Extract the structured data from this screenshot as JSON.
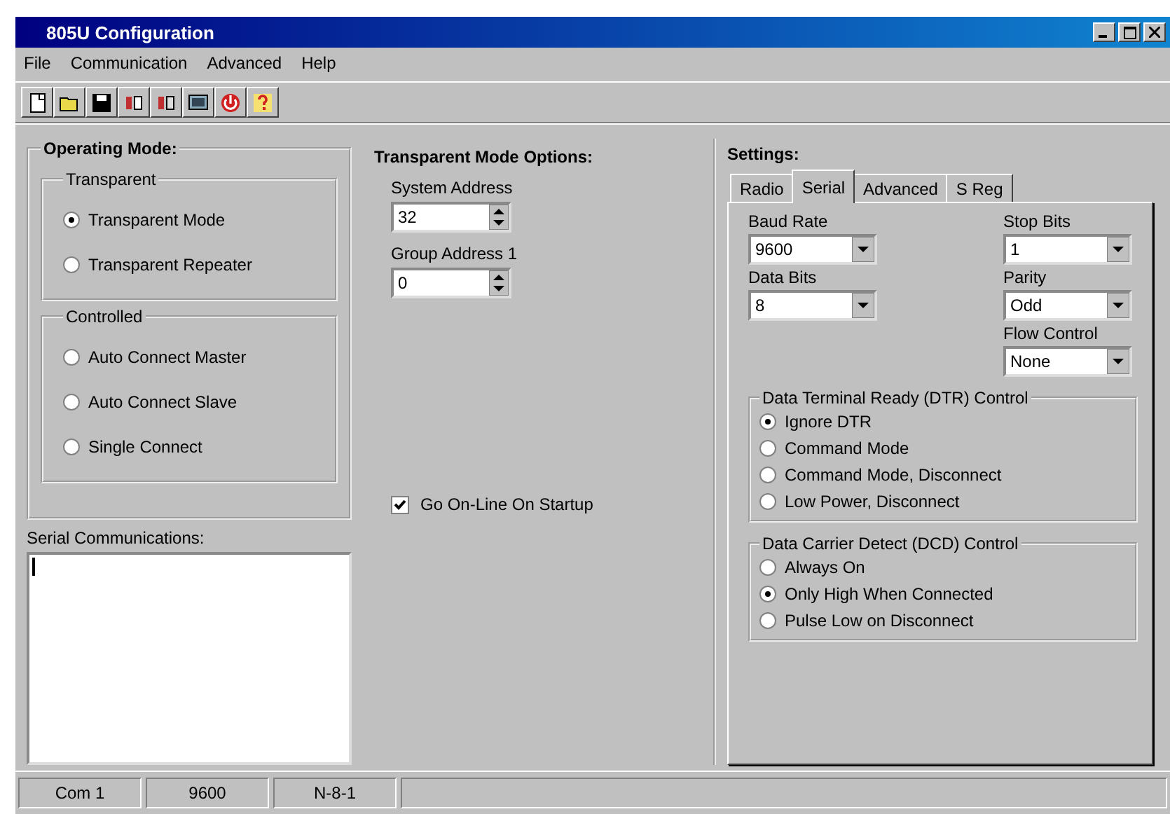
{
  "window": {
    "title": "805U Configuration"
  },
  "menu": [
    {
      "label": "File"
    },
    {
      "label": "Communication"
    },
    {
      "label": "Advanced"
    },
    {
      "label": "Help"
    }
  ],
  "operating_mode": {
    "title": "Operating Mode:",
    "groups": [
      {
        "title": "Transparent",
        "options": [
          {
            "label": "Transparent Mode",
            "selected": true
          },
          {
            "label": "Transparent Repeater",
            "selected": false
          }
        ]
      },
      {
        "title": "Controlled",
        "options": [
          {
            "label": "Auto Connect Master",
            "selected": false
          },
          {
            "label": "Auto Connect Slave",
            "selected": false
          },
          {
            "label": "Single Connect",
            "selected": false
          }
        ]
      }
    ]
  },
  "serial_communications": {
    "label": "Serial Communications:"
  },
  "transparent_options": {
    "title": "Transparent Mode Options:",
    "fields": [
      {
        "label": "System Address",
        "value": "32"
      },
      {
        "label": "Group Address 1",
        "value": "0"
      }
    ],
    "go_online": {
      "label": "Go On-Line On Startup",
      "checked": true
    }
  },
  "settings": {
    "title": "Settings:",
    "tabs": [
      {
        "label": "Radio",
        "selected": false
      },
      {
        "label": "Serial",
        "selected": true
      },
      {
        "label": "Advanced",
        "selected": false
      },
      {
        "label": "S Reg",
        "selected": false
      }
    ],
    "left_fields": [
      {
        "label": "Baud Rate",
        "value": "9600"
      },
      {
        "label": "Data Bits",
        "value": "8"
      }
    ],
    "right_fields": [
      {
        "label": "Stop Bits",
        "value": "1"
      },
      {
        "label": "Parity",
        "value": "Odd"
      },
      {
        "label": "Flow Control",
        "value": "None"
      }
    ],
    "dtr": {
      "title": "Data Terminal Ready (DTR) Control",
      "options": [
        {
          "label": "Ignore DTR",
          "selected": true
        },
        {
          "label": "Command Mode",
          "selected": false
        },
        {
          "label": "Command Mode, Disconnect",
          "selected": false
        },
        {
          "label": "Low Power, Disconnect",
          "selected": false
        }
      ]
    },
    "dcd": {
      "title": "Data Carrier Detect (DCD) Control",
      "options": [
        {
          "label": "Always On",
          "selected": false
        },
        {
          "label": "Only High When Connected",
          "selected": true
        },
        {
          "label": "Pulse Low on Disconnect",
          "selected": false
        }
      ]
    }
  },
  "status_bar": [
    "Com 1",
    "9600",
    "N-8-1"
  ]
}
